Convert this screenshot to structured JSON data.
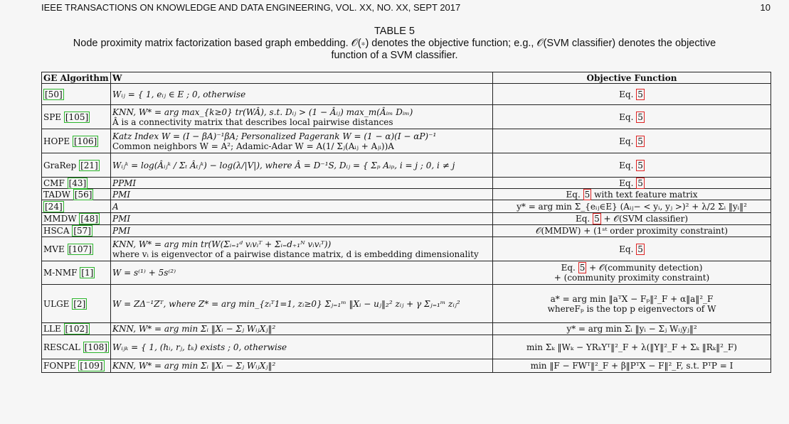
{
  "page_header": {
    "journal": "IEEE TRANSACTIONS ON KNOWLEDGE AND DATA ENGINEERING, VOL. XX, NO. XX, SEPT 2017",
    "page": "10"
  },
  "caption": {
    "label": "TABLE 5",
    "text_line1": "Node proximity matrix factorization based graph embedding. 𝒪(∗) denotes the objective function; e.g., 𝒪(SVM classifier) denotes the objective",
    "text_line2": "function of a SVM classifier."
  },
  "table": {
    "headers": [
      "GE Algorithm",
      "W",
      "Objective Function"
    ],
    "rows": [
      {
        "alg": "",
        "ref": "[50]",
        "w1": "Wᵢⱼ = { 1, eᵢⱼ ∈ E ; 0, otherwise",
        "w2": "",
        "obj_pre": "Eq. ",
        "obj_ref": "5",
        "obj_post": "",
        "obj2": ""
      },
      {
        "alg": "SPE ",
        "ref": "[105]",
        "w1": "KNN, W* = arg max_{k≥0} tr(WÂ), s.t. Dᵢⱼ > (1 − Âᵢⱼ) max_m(Âᵢₘ Dᵢₘ)",
        "w2": "Â is a connectivity matrix that describes local pairwise distances",
        "obj_pre": "Eq. ",
        "obj_ref": "5",
        "obj_post": "",
        "obj2": ""
      },
      {
        "alg": "HOPE ",
        "ref": "[106]",
        "w1": "Katz Index W = (I − βA)⁻¹βA; Personalized Pagerank W = (1 − α)(I − αP)⁻¹",
        "w2": "Common neighbors W = A²; Adamic-Adar W = A(1/ Σⱼ(Aᵢⱼ + Aⱼᵢ))A",
        "obj_pre": "Eq. ",
        "obj_ref": "5",
        "obj_post": "",
        "obj2": ""
      },
      {
        "alg": "GraRep ",
        "ref": "[21]",
        "w1": "Wᵢⱼᵏ = log(Âᵢⱼᵏ / Σₜ Âₜⱼᵏ) − log(λ/|V|), where Â = D⁻¹S, Dᵢⱼ = { Σₚ Aᵢₚ, i = j ; 0, i ≠ j",
        "w2": "",
        "obj_pre": "Eq. ",
        "obj_ref": "5",
        "obj_post": "",
        "obj2": ""
      },
      {
        "alg": "CMF ",
        "ref": "[43]",
        "w1": "PPMI",
        "w2": "",
        "obj_pre": "Eq. ",
        "obj_ref": "5",
        "obj_post": "",
        "obj2": ""
      },
      {
        "alg": "TADW ",
        "ref": "[56]",
        "w1": "PMI",
        "w2": "",
        "obj_pre": "Eq. ",
        "obj_ref": "5",
        "obj_post": " with text feature matrix",
        "obj2": ""
      },
      {
        "alg": "",
        "ref": "[24]",
        "w1": "A",
        "w2": "",
        "obj_pre": "y* = arg min Σ_{eᵢⱼ∈E} (Aᵢⱼ− < yᵢ, yⱼ >)² + λ/2 Σᵢ ‖yᵢ‖²",
        "obj_ref": "",
        "obj_post": "",
        "obj2": ""
      },
      {
        "alg": "MMDW ",
        "ref": "[48]",
        "w1": "PMI",
        "w2": "",
        "obj_pre": "Eq. ",
        "obj_ref": "5",
        "obj_post": " + 𝒪(SVM classifier)",
        "obj2": ""
      },
      {
        "alg": "HSCA ",
        "ref": "[57]",
        "w1": "PMI",
        "w2": "",
        "obj_pre": "𝒪(MMDW) + (1ˢᵗ order proximity constraint)",
        "obj_ref": "",
        "obj_post": "",
        "obj2": ""
      },
      {
        "alg": "MVE ",
        "ref": "[107]",
        "w1": "KNN, W* = arg min tr(W(Σᵢ₌₁ᵈ vᵢvᵢᵀ + Σᵢ₌d₊₁ᴺ vᵢvᵢᵀ))",
        "w2": "where vᵢ is eigenvector of a pairwise distance matrix, d is embedding dimensionality",
        "obj_pre": "Eq. ",
        "obj_ref": "5",
        "obj_post": "",
        "obj2": ""
      },
      {
        "alg": "M-NMF ",
        "ref": "[1]",
        "w1": "W = s⁽¹⁾ + 5s⁽²⁾",
        "w2": "",
        "obj_pre": "Eq. ",
        "obj_ref": "5",
        "obj_post": " + 𝒪(community detection)",
        "obj2": "+ (community proximity constraint)"
      },
      {
        "alg": "ULGE ",
        "ref": "[2]",
        "w1": "W = ZΔ⁻¹Zᵀ, where Z* = arg min_{zᵢᵀ1=1, zᵢ≥0} Σⱼ₌₁ᵐ ‖Xᵢ − uⱼ‖₂² zᵢⱼ + γ Σⱼ₌₁ᵐ zᵢⱼ²",
        "w2": "",
        "obj_pre": "a* = arg min ‖aᵀX − Fₚ‖²_F + α‖a‖²_F",
        "obj_ref": "",
        "obj_post": "",
        "obj2": "whereFₚ is the top p eigenvectors of W"
      },
      {
        "alg": "LLE ",
        "ref": "[102]",
        "w1": "KNN, W* = arg min Σᵢ ‖Xᵢ − Σⱼ WᵢⱼXⱼ‖²",
        "w2": "",
        "obj_pre": "y* = arg min Σᵢ ‖yᵢ − Σⱼ Wᵢⱼyⱼ‖²",
        "obj_ref": "",
        "obj_post": "",
        "obj2": ""
      },
      {
        "alg": "RESCAL ",
        "ref": "[108]",
        "w1": "Wᵢⱼₖ = { 1, (hᵢ, rⱼ, tₖ) exists ; 0, otherwise",
        "w2": "",
        "obj_pre": "min Σₖ ‖Wₖ − YRₖYᵀ‖²_F + λ(‖Y‖²_F + Σₖ ‖Rₖ‖²_F)",
        "obj_ref": "",
        "obj_post": "",
        "obj2": ""
      },
      {
        "alg": "FONPE ",
        "ref": "[109]",
        "w1": "KNN, W* = arg min Σᵢ ‖Xᵢ − Σⱼ WᵢⱼXⱼ‖²",
        "w2": "",
        "obj_pre": "min ‖F − FWᵀ‖²_F + β‖PᵀX − F‖²_F, s.t. PᵀP = I",
        "obj_ref": "",
        "obj_post": "",
        "obj2": ""
      }
    ]
  }
}
